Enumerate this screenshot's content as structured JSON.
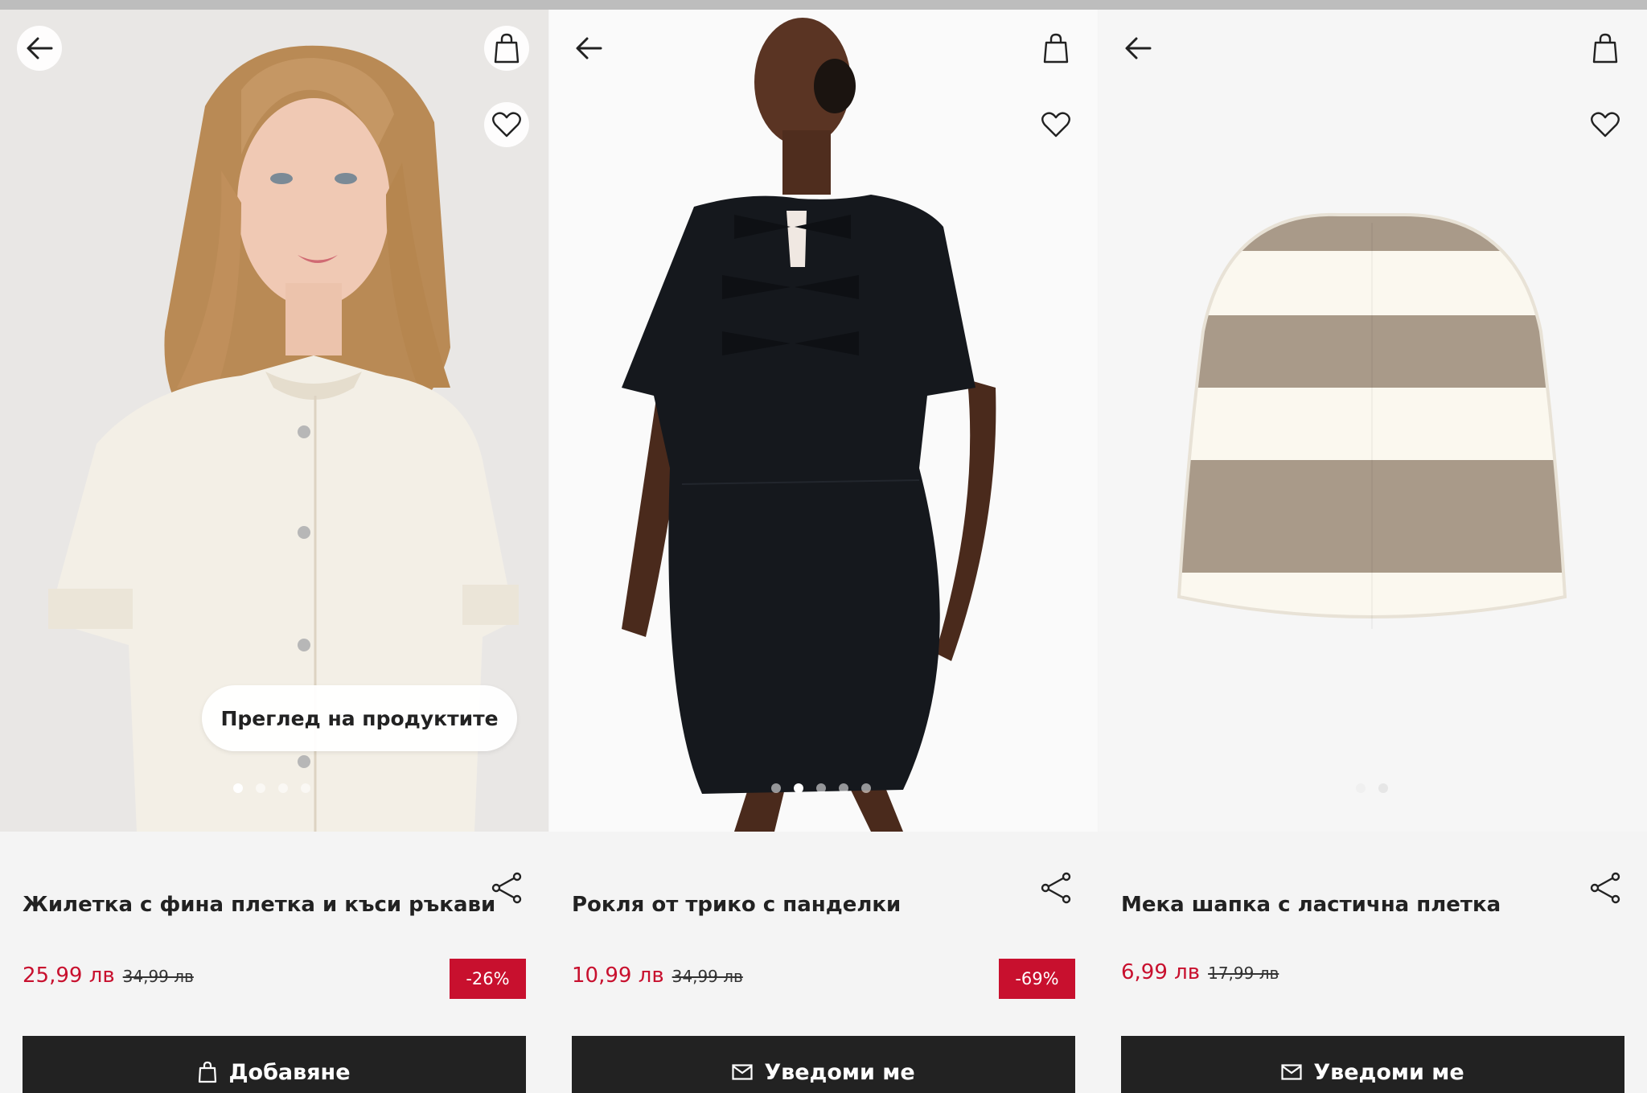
{
  "products": [
    {
      "title": "Жилетка с фина плетка и къси ръкави",
      "price_new": "25,99 лв",
      "price_old": "34,99 лв",
      "discount": "-26%",
      "action_label": "Добавяне",
      "action_icon": "bag-icon",
      "overlay_button": "Преглед на продуктите",
      "image": "girl-cream-cardigan",
      "dots_total": 4,
      "dots_active": 1,
      "colors": {
        "background": "#e9e7e5",
        "garment": "#f3efe6"
      }
    },
    {
      "title": "Рокля от трико с панделки",
      "price_new": "10,99 лв",
      "price_old": "34,99 лв",
      "discount": "-69%",
      "action_label": "Уведоми ме",
      "action_icon": "mail-icon",
      "image": "woman-black-dress",
      "dots_total": 5,
      "dots_active": 2,
      "colors": {
        "background": "#fafafa",
        "garment": "#15181d"
      }
    },
    {
      "title": "Мека шапка с ластична плетка",
      "price_new": "6,99 лв",
      "price_old": "17,99 лв",
      "action_label": "Уведоми ме",
      "action_icon": "mail-icon",
      "image": "striped-beanie",
      "dots_total": 2,
      "dots_active": 1,
      "colors": {
        "background": "#f6f6f6",
        "stripe_a": "#fbf8ef",
        "stripe_b": "#a99a89"
      }
    }
  ],
  "colors": {
    "accent": "#c8102e",
    "button": "#222222"
  }
}
